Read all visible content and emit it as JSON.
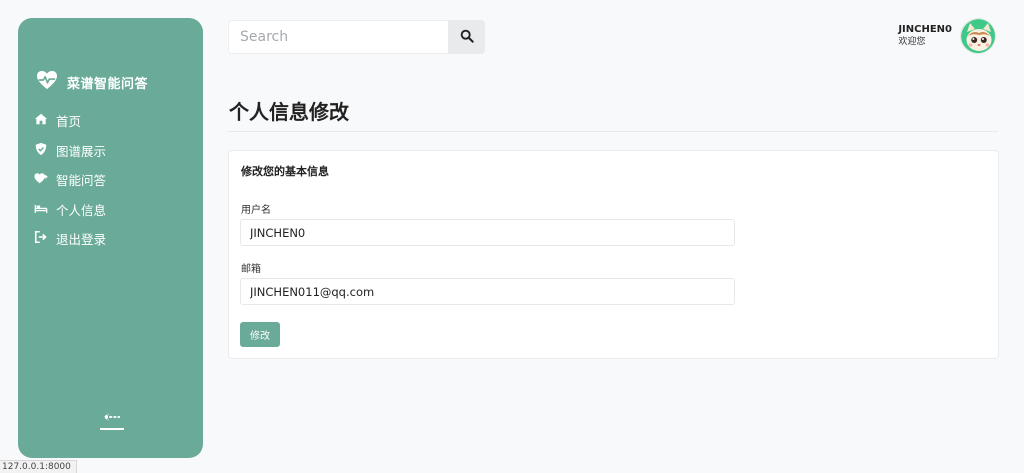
{
  "sidebar": {
    "brand": "菜谱智能问答",
    "items": [
      {
        "label": "首页",
        "icon": "home-icon"
      },
      {
        "label": "图谱展示",
        "icon": "shield-icon"
      },
      {
        "label": "智能问答",
        "icon": "heart-plus-icon"
      },
      {
        "label": "个人信息",
        "icon": "bed-icon"
      },
      {
        "label": "退出登录",
        "icon": "sign-out-icon"
      }
    ],
    "collapse_icon": "arrow-left-collapse-icon"
  },
  "search": {
    "placeholder": "Search",
    "value": "",
    "icon": "search-icon"
  },
  "user": {
    "name": "JINCHEN0",
    "welcome": "欢迎您"
  },
  "page": {
    "title": "个人信息修改"
  },
  "form": {
    "card_title": "修改您的基本信息",
    "username_label": "用户名",
    "username_value": "JINCHEN0",
    "email_label": "邮箱",
    "email_value": "JINCHEN011@qq.com",
    "submit_label": "修改"
  },
  "status_bar": {
    "url": "127.0.0.1:8000"
  },
  "colors": {
    "accent": "#6aaa98",
    "background": "#f8f9fb"
  }
}
